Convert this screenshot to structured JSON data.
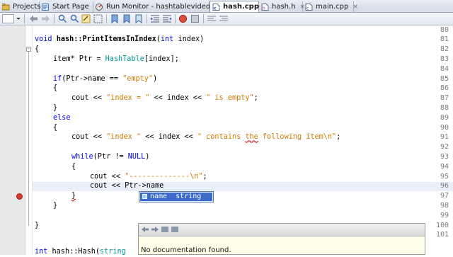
{
  "tabs": [
    {
      "label": "Projects",
      "icon": "projects-icon",
      "active": false
    },
    {
      "label": "Start Page",
      "icon": "start-page-icon",
      "active": false
    },
    {
      "label": "Run Monitor - hashtablevideo",
      "icon": "run-monitor-icon",
      "active": false
    },
    {
      "label": "hash.cpp",
      "icon": "cpp-file-icon",
      "active": true
    },
    {
      "label": "hash.h",
      "icon": "header-file-icon",
      "active": false
    },
    {
      "label": "main.cpp",
      "icon": "cpp-file-icon",
      "active": false
    }
  ],
  "tab_close_glyph": "×",
  "line_numbers": [
    "80",
    "81",
    "82",
    "83",
    "84",
    "85",
    "86",
    "87",
    "88",
    "89",
    "90",
    "91",
    "92",
    "93",
    "94",
    "95",
    "96",
    "97",
    "98",
    "99",
    "100",
    "101",
    ""
  ],
  "code": {
    "l81_type": "void",
    "l81_name": "hash::PrintItemsInIndex",
    "l81_paren": "(",
    "l81_int": "int",
    "l81_rest": " index)",
    "l82": "{",
    "l83_a": "item* Ptr = ",
    "l83_b": "HashTable",
    "l83_c": "[index];",
    "l85_if": "if",
    "l85_a": "(Ptr->name == ",
    "l85_str": "\"empty\"",
    "l85_b": ")",
    "l86": "{",
    "l87_a": "cout << ",
    "l87_s1": "\"index = \"",
    "l87_b": " << index << ",
    "l87_s2": "\" is empty\"",
    "l87_c": ";",
    "l88": "}",
    "l89_else": "else",
    "l90": "{",
    "l91_a": "cout << ",
    "l91_s1": "\"index \"",
    "l91_b": " << index << ",
    "l91_s2a": "\" contains ",
    "l91_s2err": "the",
    "l91_s2b": " following item\\n\"",
    "l91_c": ";",
    "l93_while": "while",
    "l93_a": "(Ptr != ",
    "l93_null": "NULL",
    "l93_b": ")",
    "l94": "{",
    "l95_a": "cout << ",
    "l95_str": "\"--------------\\n\"",
    "l95_b": ";",
    "l96": "cout << Ptr->name",
    "l97": "}",
    "l98": "}",
    "l100": "}",
    "l102_a": "int",
    "l102_b": " hash::Hash(",
    "l102_c": "string"
  },
  "completion": {
    "name": "name",
    "type": "string"
  },
  "documentation": {
    "text": "No documentation found."
  },
  "colors": {
    "keyword": "#0000e6",
    "string": "#ce7b00",
    "type_highlight": "#009999",
    "selection": "#3d6bc7",
    "error": "#d93a2b"
  }
}
